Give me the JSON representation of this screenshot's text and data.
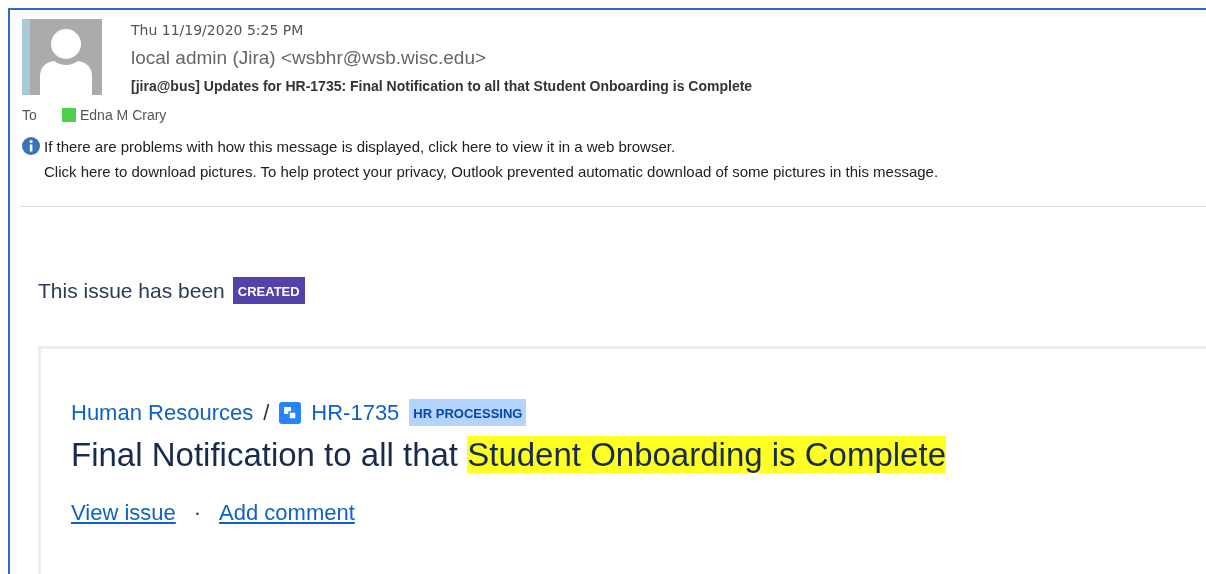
{
  "email": {
    "date": "Thu 11/19/2020 5:25 PM",
    "sender": "local admin (Jira) <wsbhr@wsb.wisc.edu>",
    "subject": "[jira@bus] Updates for HR-1735: Final Notification to all that Student Onboarding is Complete",
    "to_label": "To",
    "recipients": [
      {
        "name": "Edna M Crary",
        "color": "#4cd04c"
      }
    ],
    "info_lines": [
      "If there are problems with how this message is displayed, click here to view it in a web browser.",
      "Click here to download pictures. To help protect your privacy, Outlook prevented automatic download of some pictures in this message."
    ]
  },
  "body": {
    "intro": "This issue has been",
    "status_badge": "CREATED",
    "issue": {
      "project": "Human Resources",
      "separator": "/",
      "key": "HR-1735",
      "status": "HR PROCESSING",
      "title": "Final Notification to all that ",
      "title_highlight": "Student Onboarding is Complete",
      "actions": [
        {
          "label": "View issue"
        },
        {
          "label": "Add comment"
        }
      ],
      "action_separator": "·"
    }
  }
}
